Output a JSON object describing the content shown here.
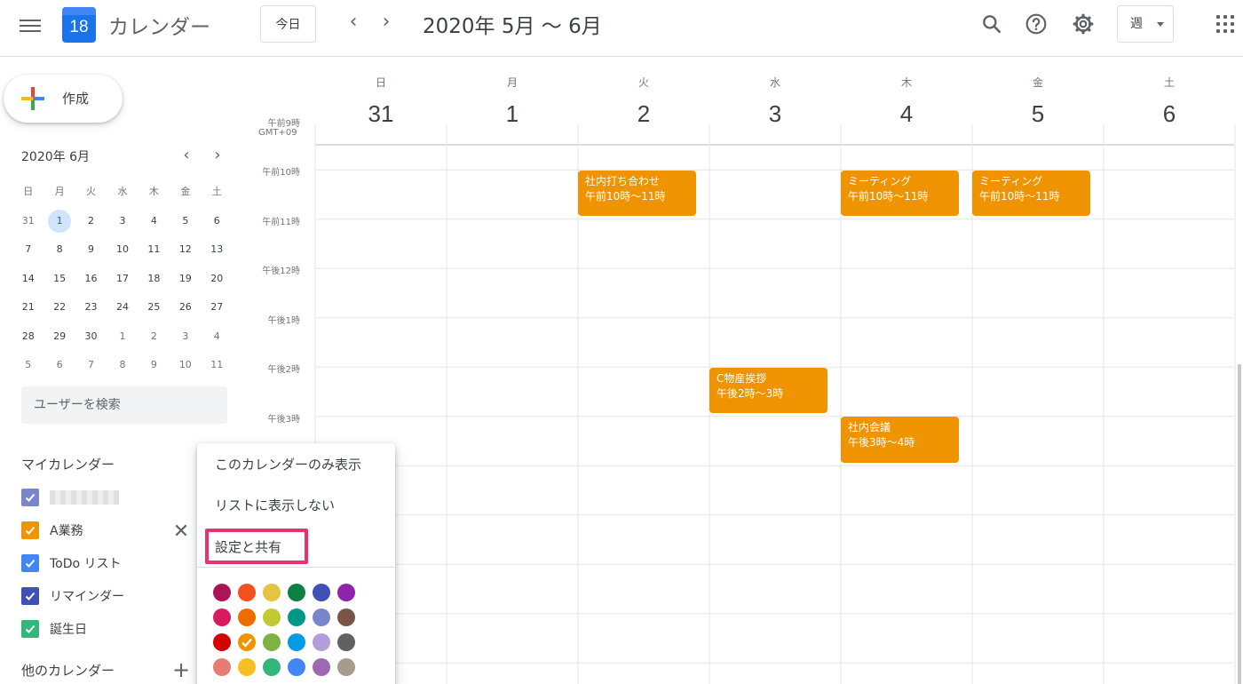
{
  "header": {
    "logo_day": "18",
    "app_title": "カレンダー",
    "today_label": "今日",
    "prev_arrow": "‹",
    "next_arrow": "›",
    "date_range": "2020年 5月 〜 6月",
    "view_label": "週"
  },
  "sidebar": {
    "create_label": "作成",
    "mini_month_title": "2020年 6月",
    "weekday_headers": [
      "日",
      "月",
      "火",
      "水",
      "木",
      "金",
      "土"
    ],
    "weeks": [
      [
        "31",
        "1",
        "2",
        "3",
        "4",
        "5",
        "6"
      ],
      [
        "7",
        "8",
        "9",
        "10",
        "11",
        "12",
        "13"
      ],
      [
        "14",
        "15",
        "16",
        "17",
        "18",
        "19",
        "20"
      ],
      [
        "21",
        "22",
        "23",
        "24",
        "25",
        "26",
        "27"
      ],
      [
        "28",
        "29",
        "30",
        "1",
        "2",
        "3",
        "4"
      ],
      [
        "5",
        "6",
        "7",
        "8",
        "9",
        "10",
        "11"
      ]
    ],
    "selected_day": "1",
    "search_placeholder": "ユーザーを検索",
    "my_calendars_title": "マイカレンダー",
    "my_calendars": [
      {
        "name": "",
        "color": "#7986cb",
        "blurred": true
      },
      {
        "name": "A業務",
        "color": "#f09300"
      },
      {
        "name": "ToDo リスト",
        "color": "#4285f4"
      },
      {
        "name": "リマインダー",
        "color": "#3f51b5"
      },
      {
        "name": "誕生日",
        "color": "#33b679"
      }
    ],
    "other_calendars_title": "他のカレンダー"
  },
  "week": {
    "days": [
      {
        "dow": "日",
        "num": "31"
      },
      {
        "dow": "月",
        "num": "1"
      },
      {
        "dow": "火",
        "num": "2"
      },
      {
        "dow": "水",
        "num": "3"
      },
      {
        "dow": "木",
        "num": "4"
      },
      {
        "dow": "金",
        "num": "5"
      },
      {
        "dow": "土",
        "num": "6"
      }
    ],
    "timezone": "GMT+09",
    "time_labels": [
      "午前9時",
      "午前10時",
      "午前11時",
      "午後12時",
      "午後1時",
      "午後2時",
      "午後3時"
    ],
    "events": [
      {
        "title": "社内打ち合わせ",
        "time": "午前10時〜11時",
        "day": 1,
        "start": 10,
        "end": 11
      },
      {
        "title": "ミーティング",
        "time": "午前10時〜11時",
        "day": 3,
        "start": 10,
        "end": 11
      },
      {
        "title": "ミーティング",
        "time": "午前10時〜11時",
        "day": 4,
        "start": 10,
        "end": 11
      },
      {
        "title": "C物産挨拶",
        "time": "午後2時〜3時",
        "day": 2,
        "start": 14,
        "end": 15
      },
      {
        "title": "社内会議",
        "time": "午後3時〜4時",
        "day": 3,
        "start": 15,
        "end": 16
      }
    ],
    "event_color": "#f09300"
  },
  "context_menu": {
    "items": [
      "このカレンダーのみ表示",
      "リストに表示しない",
      "設定と共有"
    ],
    "highlight_color": "#e8336e",
    "selected_color": "#f09300",
    "colors": [
      [
        "#ad1457",
        "#f4511e",
        "#e4c441",
        "#0b8043",
        "#3f51b5",
        "#8e24aa"
      ],
      [
        "#d81b60",
        "#ef6c00",
        "#c0ca33",
        "#009688",
        "#7986cb",
        "#795548"
      ],
      [
        "#d50000",
        "#f09300",
        "#7cb342",
        "#039be5",
        "#b39ddb",
        "#616161"
      ],
      [
        "#e67c73",
        "#f6bf26",
        "#33b679",
        "#4285f4",
        "#9e69af",
        "#a79b8e"
      ]
    ]
  }
}
